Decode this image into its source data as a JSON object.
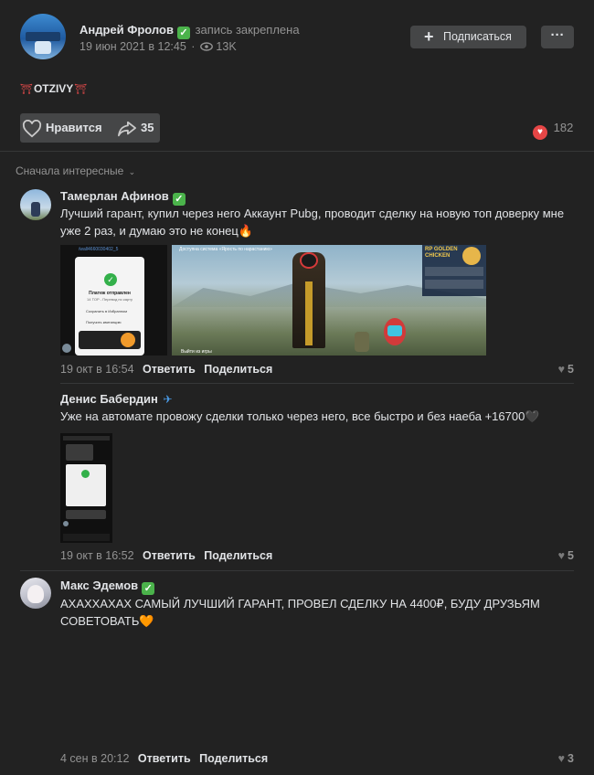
{
  "post": {
    "author": "Андрей Фролов",
    "pinned": "запись закреплена",
    "date": "19 июн 2021 в 12:45",
    "views": "13K",
    "subscribe_label": "Подписаться",
    "more_label": "···",
    "text": "OTZIVY",
    "like_label": "Нравится",
    "share_count": "35",
    "reactions_count": "182"
  },
  "sort": {
    "label": "Сначала интересные"
  },
  "comments": [
    {
      "author": "Тамерлан Афинов",
      "text": "Лучший гарант, купил через него Аккаунт Pubg, проводит сделку на новую топ доверку мне уже 2 раз, и думаю это не конец🔥",
      "date": "19 окт в 16:54",
      "reply_label": "Ответить",
      "share_label": "Поделиться",
      "likes": "5",
      "images": {
        "screenshot_link": "/wall4660030402_5",
        "screenshot_title": "Платеж отправлен",
        "screenshot_sub": "14 ТОР - Перевод по карту",
        "screenshot_save": "Сохранить в Избранном",
        "screenshot_receipt": "Получить квитанцию",
        "game_banner": "RP GOLDEN CHICKEN",
        "game_top": "Доступна система «Ярость по нарастанию»",
        "game_bottom": "Выйти из игры"
      }
    },
    {
      "author": "Денис Бабердин",
      "text": "Уже на автомате провожу сделки только через него, все быстро и без наеба +16700🖤",
      "date": "19 окт в 16:52",
      "reply_label": "Ответить",
      "share_label": "Поделиться",
      "likes": "5"
    },
    {
      "author": "Макс Эдемов",
      "text": "АХАХХАХАХ САМЫЙ ЛУЧШИЙ ГАРАНТ, ПРОВЕЛ СДЕЛКУ НА 4400₽, БУДУ ДРУЗЬЯМ СОВЕТОВАТЬ🧡",
      "date": "4 сен в 20:12",
      "reply_label": "Ответить",
      "share_label": "Поделиться",
      "likes": "3"
    }
  ],
  "colors": {
    "background": "#222222",
    "verified": "#4bb34b",
    "reaction": "#e64646"
  }
}
